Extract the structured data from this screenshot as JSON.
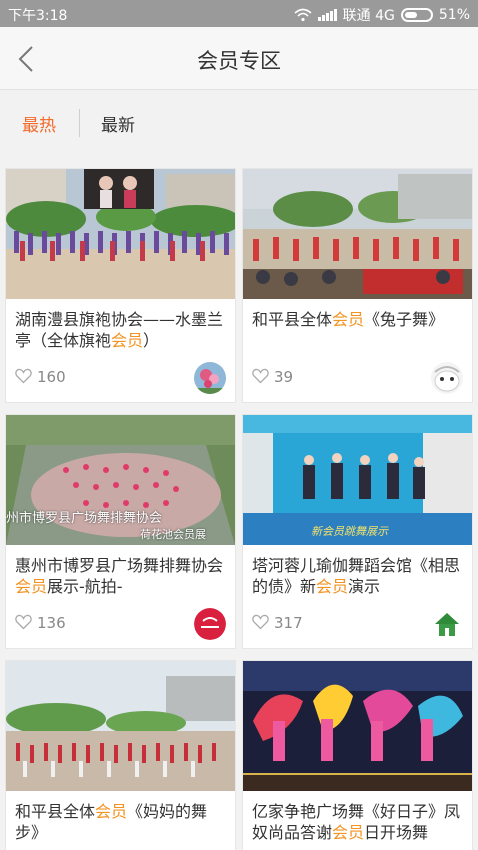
{
  "status_bar": {
    "time": "下午3:18",
    "carrier": "联通 4G",
    "battery": "51%"
  },
  "header": {
    "title": "会员专区"
  },
  "tabs": [
    {
      "label": "最热",
      "active": true
    },
    {
      "label": "最新",
      "active": false
    }
  ],
  "cards": [
    {
      "caption_before": "湖南澧县旗袍协会——水墨兰亭（全体旗袍",
      "highlight": "会员",
      "caption_after": "）",
      "likes": "160",
      "avatar_icon": "flowers-avatar-icon"
    },
    {
      "caption_before": "和平县全体",
      "highlight": "会员",
      "caption_after": "《兔子舞》",
      "likes": "39",
      "avatar_icon": "cartoon-face-avatar-icon"
    },
    {
      "caption_before": "惠州市博罗县广场舞排舞协会",
      "highlight": "会员",
      "caption_after": "展示-航拍-",
      "likes": "136",
      "avatar_icon": "red-logo-avatar-icon",
      "overlay_text": "州市博罗县广场舞排舞协会",
      "overlay_text2": "荷花池会员展"
    },
    {
      "caption_before": "塔河蓉儿瑜伽舞蹈会馆《相思的债》新",
      "highlight": "会员",
      "caption_after": "演示",
      "likes": "317",
      "avatar_icon": "green-house-avatar-icon",
      "overlay_text": "新会员跳舞展示"
    },
    {
      "caption_before": "和平县全体",
      "highlight": "会员",
      "caption_after": "《妈妈的舞步》",
      "likes": ""
    },
    {
      "caption_before": "亿家争艳广场舞《好日子》凤奴尚品答谢",
      "highlight": "会员",
      "caption_after": "日开场舞",
      "likes": ""
    }
  ],
  "colors": {
    "accent": "#f26b2a",
    "highlight": "#f29322",
    "status_bar": "#9a9a9a"
  }
}
